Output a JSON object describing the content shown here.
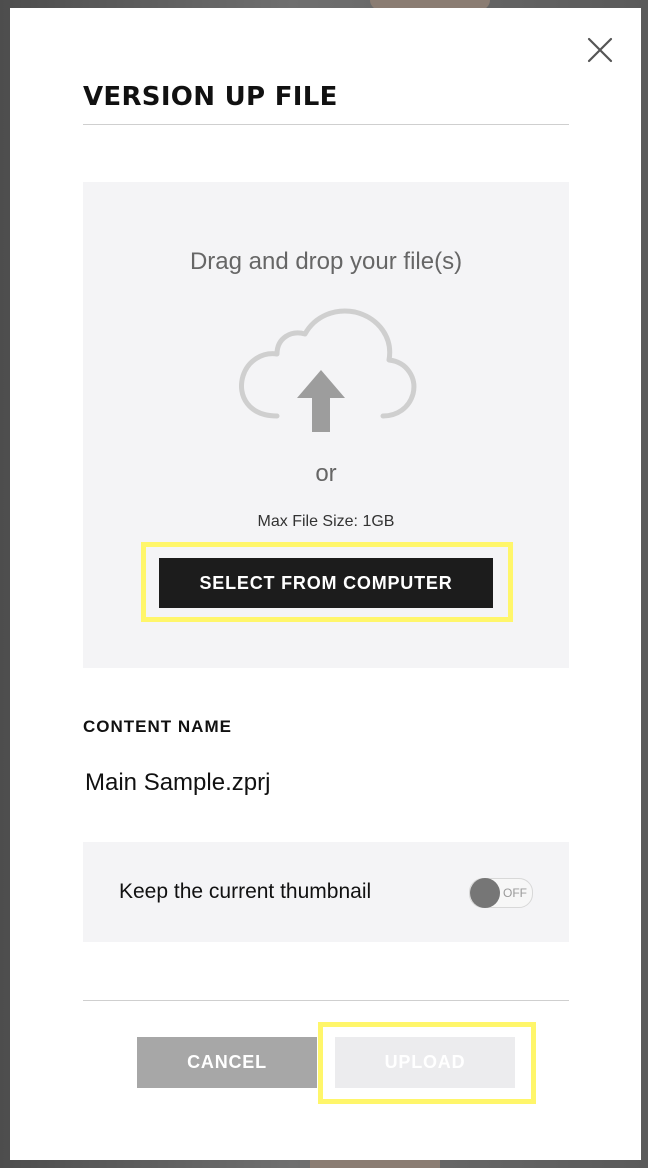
{
  "dialog": {
    "title": "VERSION UP FILE"
  },
  "dropzone": {
    "prompt": "Drag and drop your file(s)",
    "icon": "cloud-upload-icon",
    "or_text": "or",
    "max_size": "Max File Size: 1GB",
    "select_label": "SELECT FROM COMPUTER"
  },
  "content": {
    "label": "CONTENT NAME",
    "value": "Main Sample.zprj"
  },
  "thumbnail": {
    "label": "Keep the current thumbnail",
    "toggle_state": "OFF",
    "enabled": false
  },
  "actions": {
    "cancel_label": "CANCEL",
    "upload_label": "UPLOAD",
    "upload_enabled": false
  },
  "colors": {
    "highlight": "#fff66a",
    "primary_button": "#1c1c1c",
    "cancel_button": "#a7a7a7",
    "disabled_button": "#ececee",
    "panel_background": "#f4f4f6"
  }
}
